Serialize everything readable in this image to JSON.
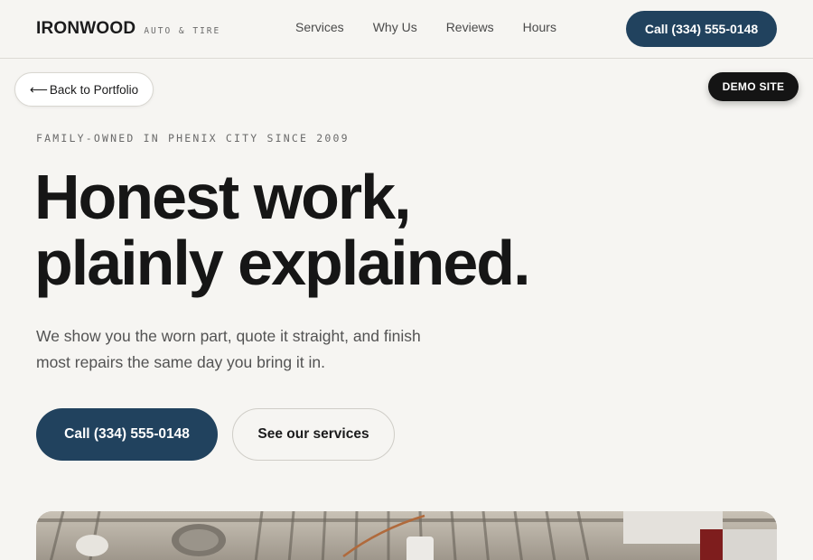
{
  "header": {
    "logo_main": "IRONWOOD",
    "logo_sub": "AUTO & TIRE",
    "nav": [
      {
        "label": "Services"
      },
      {
        "label": "Why Us"
      },
      {
        "label": "Reviews"
      },
      {
        "label": "Hours"
      }
    ],
    "call_button": "Call (334) 555-0148"
  },
  "overlay": {
    "back_label": "Back to Portfolio",
    "back_icon": "arrow-left-icon",
    "demo_badge": "DEMO SITE"
  },
  "hero": {
    "eyebrow": "FAMILY-OWNED IN PHENIX CITY SINCE 2009",
    "headline_line1": "Honest work,",
    "headline_line2": "plainly explained.",
    "subtext": "We show you the worn part, quote it straight, and finish most repairs the same day you bring it in.",
    "primary_cta": "Call (334) 555-0148",
    "secondary_cta": "See our services"
  },
  "colors": {
    "background": "#f6f5f2",
    "brand_navy": "#21425e",
    "ink": "#161616",
    "badge": "#141414"
  }
}
